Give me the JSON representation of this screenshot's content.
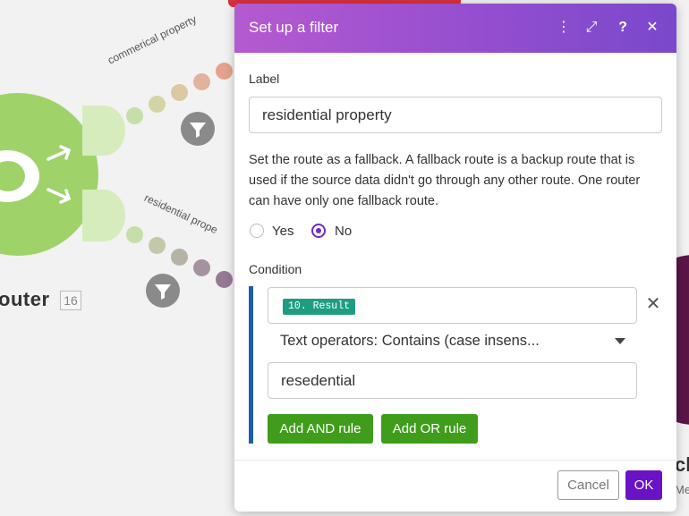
{
  "canvas": {
    "router_label": "outer",
    "router_badge": "16",
    "route_1_label": "commerical property",
    "route_2_label": "residential prope",
    "right_label": "cl",
    "right_sub": "Me"
  },
  "dialog": {
    "title": "Set up a filter",
    "header_icons": [
      "more-vertical-icon",
      "expand-icon",
      "help-icon",
      "close-icon"
    ],
    "header_glyphs": {
      "more": "⋮",
      "expand": "⤢",
      "help": "?",
      "close": "✕"
    },
    "label_caption": "Label",
    "label_value": "residential property",
    "fallback_help": "Set the route as a fallback. A fallback route is a backup route that is used if the source data didn't go through any other route. One router can have only one fallback route.",
    "fallback_options": [
      "Yes",
      "No"
    ],
    "fallback_selected": "No",
    "condition_caption": "Condition",
    "condition": {
      "operand_chip": "10. Result",
      "operator": "Text operators: Contains (case insens...",
      "value": "resedential",
      "remove_glyph": "✕"
    },
    "add_and_rule": "Add AND rule",
    "add_or_rule": "Add OR rule",
    "cancel": "Cancel",
    "ok": "OK"
  },
  "colors": {
    "header_gradient": [
      "#b55ad0",
      "#7a48cc"
    ],
    "router_green": "#9fd36a",
    "chip": "#1f9d81",
    "green_button": "#3f9d1b",
    "ok_button": "#6a12c6",
    "condition_bar": "#1f5fa7"
  }
}
